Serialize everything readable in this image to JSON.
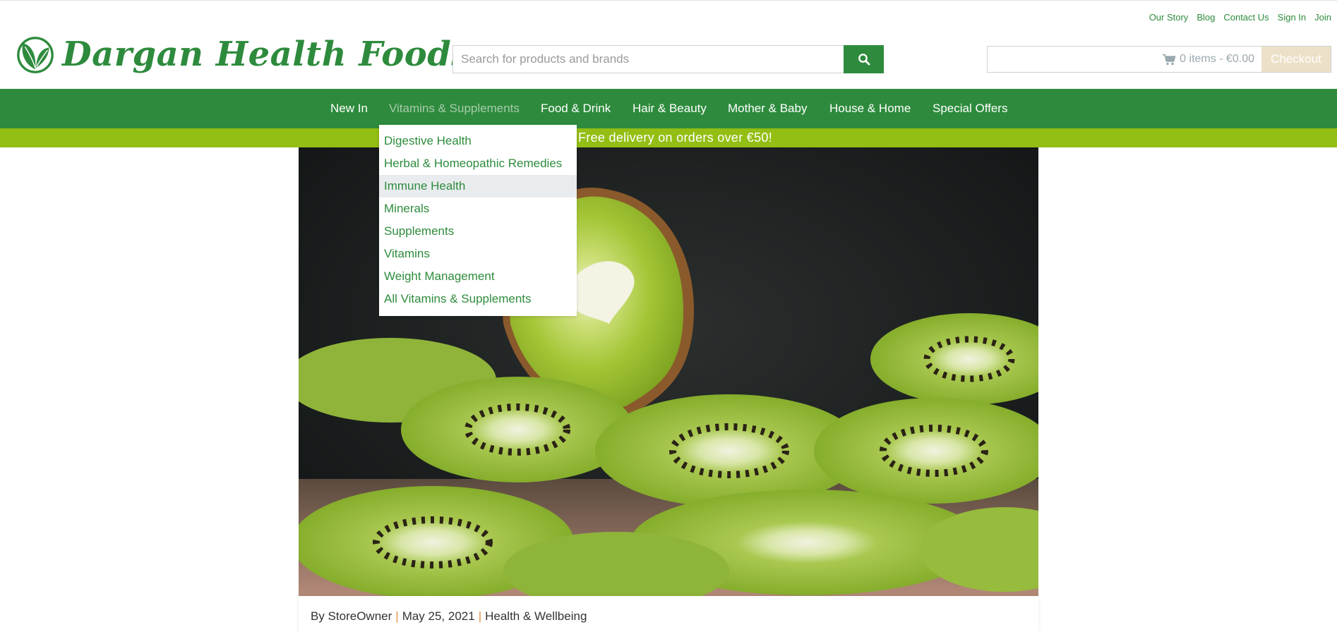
{
  "top_links": [
    "Our Story",
    "Blog",
    "Contact Us",
    "Sign In",
    "Join"
  ],
  "brand": {
    "name": "Dargan Health Foods",
    "color": "#2e8b3d"
  },
  "search": {
    "placeholder": "Search for products and brands",
    "value": "",
    "icon": "search-icon"
  },
  "cart": {
    "summary": "0 items - €0.00",
    "checkout_label": "Checkout",
    "icon": "cart-icon"
  },
  "nav": {
    "items": [
      "New In",
      "Vitamins & Supplements",
      "Food & Drink",
      "Hair & Beauty",
      "Mother & Baby",
      "House & Home",
      "Special Offers"
    ],
    "active": "Vitamins & Supplements"
  },
  "dropdown": {
    "items": [
      "Digestive Health",
      "Herbal & Homeopathic Remedies",
      "Immune Health",
      "Minerals",
      "Supplements",
      "Vitamins",
      "Weight Management",
      "All Vitamins & Supplements"
    ],
    "highlighted": "Immune Health"
  },
  "promo": {
    "text": "Free delivery on orders over €50!"
  },
  "post": {
    "author": "By StoreOwner",
    "date": "May 25, 2021",
    "category": "Health & Wellbeing",
    "separator": "|"
  },
  "colors": {
    "primary_green": "#2e8b3d",
    "promo_green": "#93be13",
    "checkout_beige": "#ece1c8",
    "dropdown_hover": "#e9ecef"
  }
}
